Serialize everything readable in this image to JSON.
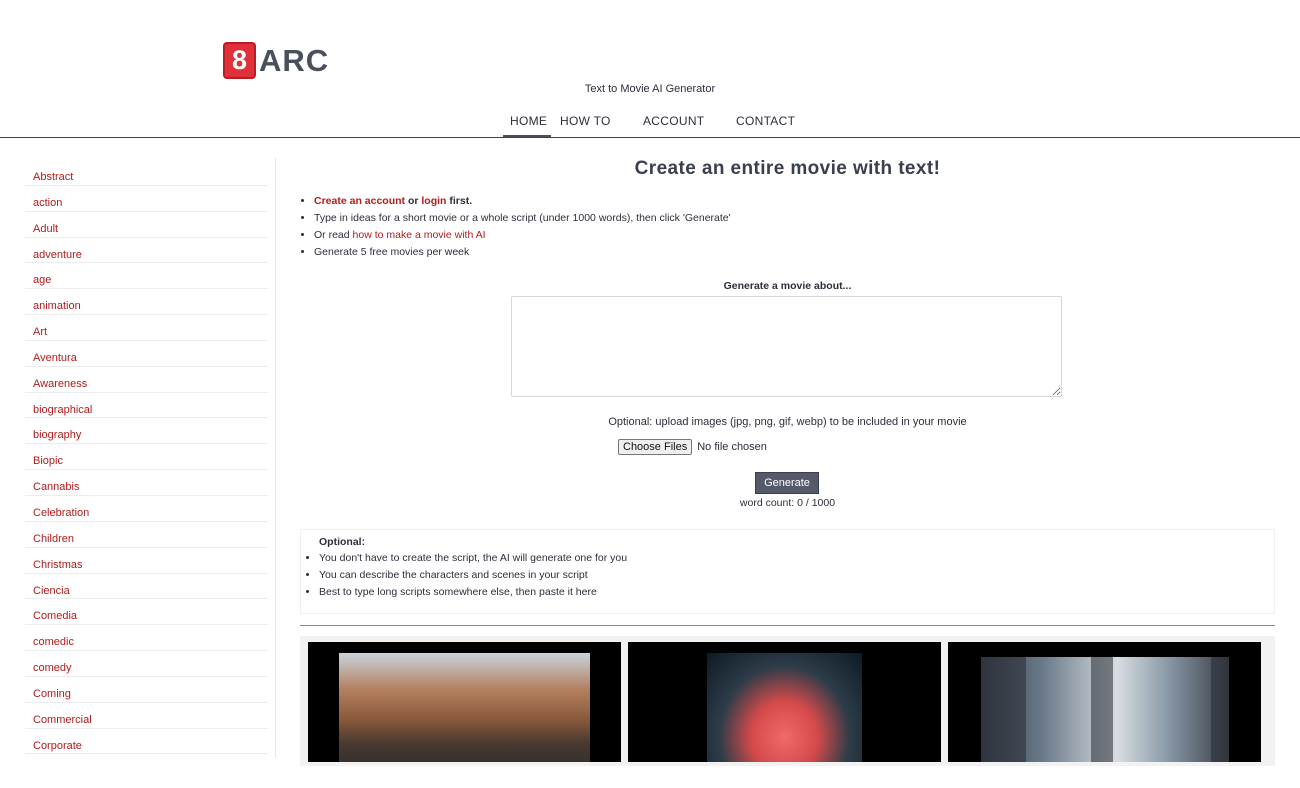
{
  "brand": {
    "badge": "8",
    "name": "ARC",
    "tagline": "Text to Movie AI Generator",
    "accent": "#e0303a"
  },
  "nav": [
    {
      "label": "HOME",
      "active": true
    },
    {
      "label": "HOW TO",
      "active": false
    },
    {
      "label": "ACCOUNT",
      "active": false
    },
    {
      "label": "CONTACT",
      "active": false
    }
  ],
  "sidebar": {
    "categories": [
      "Abstract",
      "action",
      "Adult",
      "adventure",
      "age",
      "animation",
      "Art",
      "Aventura",
      "Awareness",
      "biographical",
      "biography",
      "Biopic",
      "Cannabis",
      "Celebration",
      "Children",
      "Christmas",
      "Ciencia",
      "Comedia",
      "comedic",
      "comedy",
      "Coming",
      "Commercial",
      "Corporate"
    ]
  },
  "main": {
    "title": "Create an entire movie with text!",
    "intro": {
      "create_account": "Create an account",
      "or": " or ",
      "login": "login",
      "first": " first.",
      "item2": "Type in ideas for a short movie or a whole script (under 1000 words), then click 'Generate'",
      "item3_prefix": "Or read ",
      "item3_link": "how to make a movie with AI",
      "item4": "Generate 5 free movies per week"
    },
    "generate_label": "Generate a movie about...",
    "textarea_value": "",
    "upload_label": "Optional: upload images (jpg, png, gif, webp) to be included in your movie",
    "choose_files": "Choose Files",
    "file_status": "No file chosen",
    "generate_button": "Generate",
    "word_count": "word count: 0 / 1000",
    "optional": {
      "title": "Optional:",
      "items": [
        "You don't have to create the script, the AI will generate one for you",
        "You can describe the characters and scenes in your script",
        "Best to type long scripts somewhere else, then paste it here"
      ]
    }
  }
}
